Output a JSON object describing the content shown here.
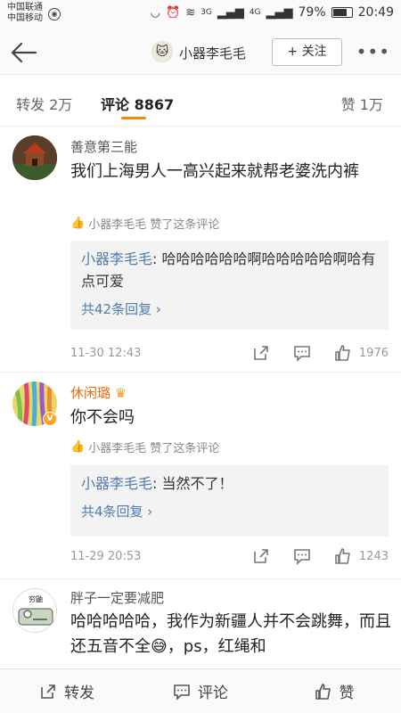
{
  "status": {
    "carrier1": "中国联通",
    "carrier2": "中国移动",
    "net1": "3G",
    "net2": "4G",
    "battery": "79%",
    "time": "20:49"
  },
  "header": {
    "name": "小器李毛毛",
    "follow_label": "+ 关注"
  },
  "tabs": {
    "repost": "转发 2万",
    "comment": "评论 8867",
    "like": "赞 1万"
  },
  "comments": [
    {
      "name": "善意第三能",
      "text": "我们上海男人一高兴起来就帮老婆洗内裤",
      "liked_by": "小器李毛毛 赞了这条评论",
      "reply_user": "小器李毛毛",
      "reply_text": ": 哈哈哈哈哈哈啊哈哈哈哈哈啊哈有点可爱",
      "reply_more": "共42条回复 ›",
      "time": "11-30 12:43",
      "likes": "1976"
    },
    {
      "name": "休闲璐",
      "text": "你不会吗",
      "liked_by": "小器李毛毛 赞了这条评论",
      "reply_user": "小器李毛毛",
      "reply_text": ": 当然不了！",
      "reply_more": "共4条回复 ›",
      "time": "11-29 20:53",
      "likes": "1243"
    },
    {
      "name": "胖子一定要减肥",
      "text": "哈哈哈哈哈，我作为新疆人并不会跳舞，而且还五音不全😅，ps，红绳和",
      "avatar_text": "穷鼬"
    }
  ],
  "bottom": {
    "repost": "转发",
    "comment": "评论",
    "like": "赞"
  },
  "colors": {
    "accent": "#ff8200",
    "link": "#507daf",
    "vip_name": "#e86b0c"
  }
}
